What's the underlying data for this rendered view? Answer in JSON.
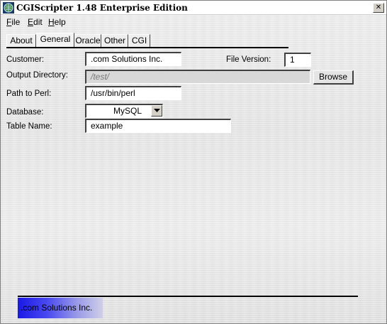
{
  "window": {
    "title": "CGIScripter 1.48 Enterprise Edition",
    "close_glyph": "✕"
  },
  "menu": {
    "file": {
      "underline": "F",
      "rest": "ile"
    },
    "edit": {
      "underline": "E",
      "rest": "dit"
    },
    "help": {
      "underline": "H",
      "rest": "elp"
    }
  },
  "tabs": [
    {
      "label": "About",
      "active": false
    },
    {
      "label": "General",
      "active": true
    },
    {
      "label": "Oracle",
      "active": false
    },
    {
      "label": "Other",
      "active": false
    },
    {
      "label": "CGI",
      "active": false
    }
  ],
  "form": {
    "customer_label": "Customer:",
    "customer_value": ".com Solutions Inc.",
    "file_version_label": "File Version:",
    "file_version_value": "1",
    "output_dir_label": "Output Directory:",
    "output_dir_value": "/test/",
    "browse_label": "Browse",
    "perl_label": "Path to Perl:",
    "perl_value": "/usr/bin/perl",
    "database_label": "Database:",
    "database_value": "MySQL",
    "table_label": "Table Name:",
    "table_value": "example"
  },
  "footer": {
    "brand": ".com Solutions Inc."
  },
  "colors": {
    "brand_gradient_start": "#1a18e6",
    "brand_gradient_end": "#cfcfe8"
  },
  "icons": [
    "app-globe-icon",
    "close-icon",
    "dropdown-arrow-icon"
  ]
}
